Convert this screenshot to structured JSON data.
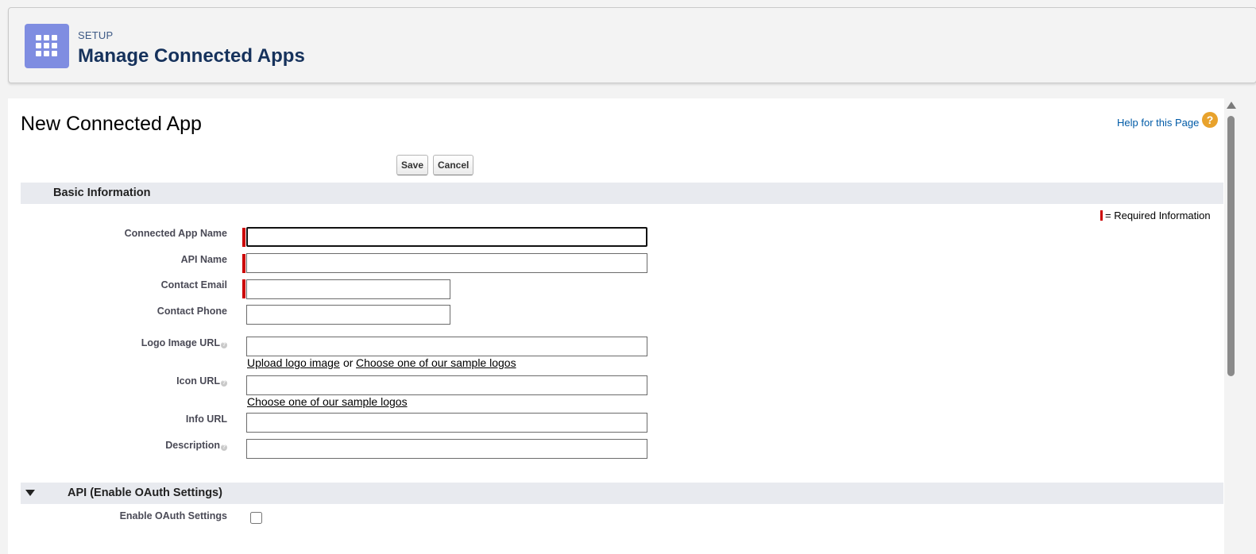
{
  "header": {
    "eyebrow": "SETUP",
    "title": "Manage Connected Apps",
    "icon": "app-launcher-grid-icon"
  },
  "page": {
    "title": "New Connected App",
    "help_link": "Help for this Page",
    "help_icon": "?"
  },
  "buttons": {
    "save": "Save",
    "cancel": "Cancel"
  },
  "basic_info": {
    "section_title": "Basic Information",
    "required_legend": "= Required Information",
    "fields": {
      "connected_app_name": {
        "label": "Connected App Name",
        "value": "",
        "required": true
      },
      "api_name": {
        "label": "API Name",
        "value": "",
        "required": true
      },
      "contact_email": {
        "label": "Contact Email",
        "value": "",
        "required": true
      },
      "contact_phone": {
        "label": "Contact Phone",
        "value": "",
        "required": false
      },
      "logo_image_url": {
        "label": "Logo Image URL",
        "value": "",
        "required": false
      },
      "icon_url": {
        "label": "Icon URL",
        "value": "",
        "required": false
      },
      "info_url": {
        "label": "Info URL",
        "value": "",
        "required": false
      },
      "description": {
        "label": "Description",
        "value": "",
        "required": false
      }
    },
    "upload_logo_link": "Upload logo image",
    "or_text": "or",
    "choose_sample_logos_link": "Choose one of our sample logos"
  },
  "api_section": {
    "section_title": "API (Enable OAuth Settings)",
    "enable_oauth_label": "Enable OAuth Settings",
    "enable_oauth_checked": false
  },
  "colors": {
    "app_icon_bg": "#7f8de1",
    "required_marker": "#cc0000",
    "link_blue": "#015ba7",
    "section_bar": "#e8eaef",
    "help_icon": "#e8a22c"
  }
}
